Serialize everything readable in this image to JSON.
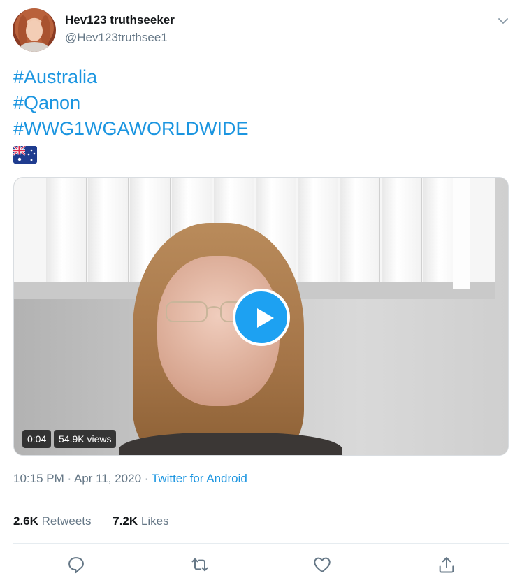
{
  "user": {
    "display_name": "Hev123 truthseeker",
    "handle": "@Hev123truthsee1"
  },
  "tweet": {
    "lines": [
      "#Australia",
      "#Qanon",
      "#WWG1WGAWORLDWIDE"
    ],
    "flag_emoji": "australia-flag"
  },
  "media": {
    "duration": "0:04",
    "views": "54.9K views"
  },
  "meta": {
    "time": "10:15 PM",
    "separator1": " · ",
    "date": "Apr 11, 2020",
    "separator2": " · ",
    "source": "Twitter for Android"
  },
  "stats": {
    "retweets_count": "2.6K",
    "retweets_label": " Retweets",
    "likes_count": "7.2K",
    "likes_label": " Likes"
  },
  "colors": {
    "link": "#1b95e0",
    "accent": "#1da1f2",
    "muted": "#657786"
  },
  "icons": [
    "chevron-down-icon",
    "play-icon",
    "reply-icon",
    "retweet-icon",
    "like-icon",
    "share-icon"
  ]
}
